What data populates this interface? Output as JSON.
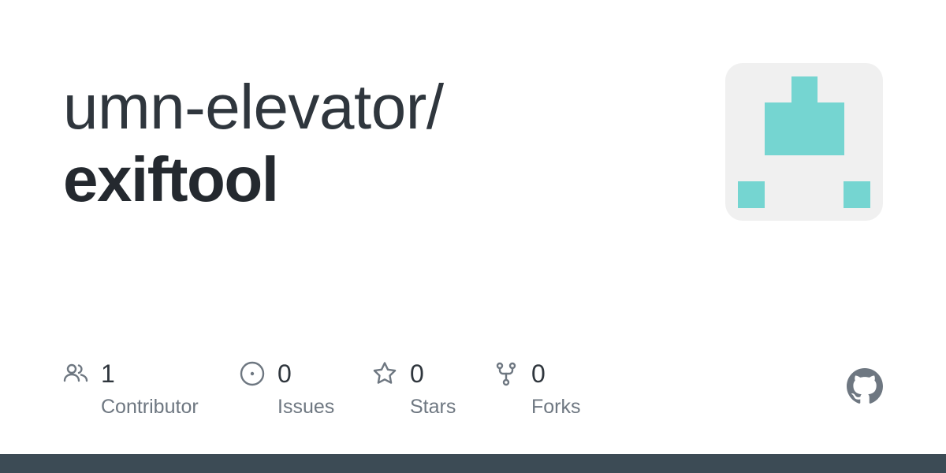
{
  "repo": {
    "owner": "umn-elevator/",
    "name": "exiftool"
  },
  "avatar": {
    "background": "#f0f0f0",
    "accent": "#75d5d1"
  },
  "stats": [
    {
      "count": "1",
      "label": "Contributor",
      "icon": "people-icon"
    },
    {
      "count": "0",
      "label": "Issues",
      "icon": "issue-opened-icon"
    },
    {
      "count": "0",
      "label": "Stars",
      "icon": "star-icon"
    },
    {
      "count": "0",
      "label": "Forks",
      "icon": "repo-forked-icon"
    }
  ],
  "colors": {
    "text_primary": "#24292f",
    "text_secondary": "#6e7781",
    "icon": "#6e7781",
    "footer": "#3c4b55"
  },
  "footer_icon": "github-logo-icon"
}
